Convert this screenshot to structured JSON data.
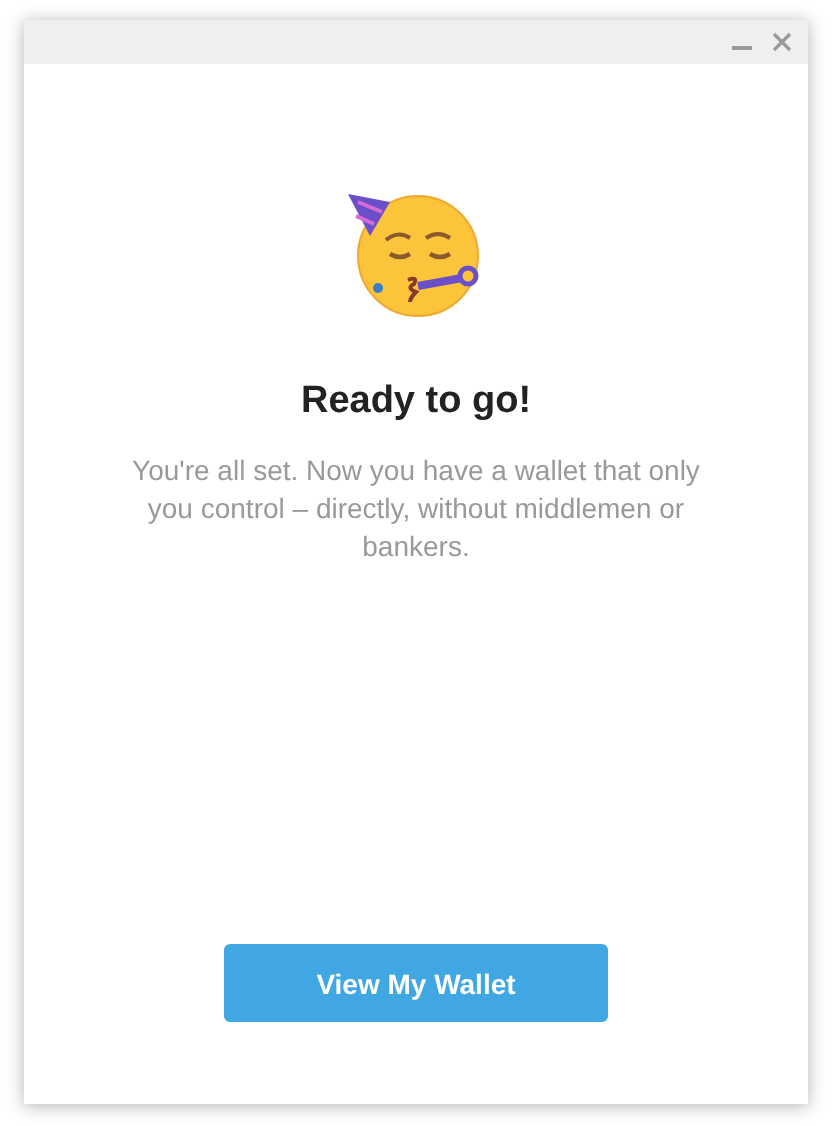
{
  "window": {
    "controls": [
      {
        "kind": "minimize"
      },
      {
        "kind": "close"
      }
    ]
  },
  "title": "Ready to go!",
  "message": "You're all set. Now you have a wallet that only you control – directly, without middlemen or bankers.",
  "button": "View My Wallet"
}
